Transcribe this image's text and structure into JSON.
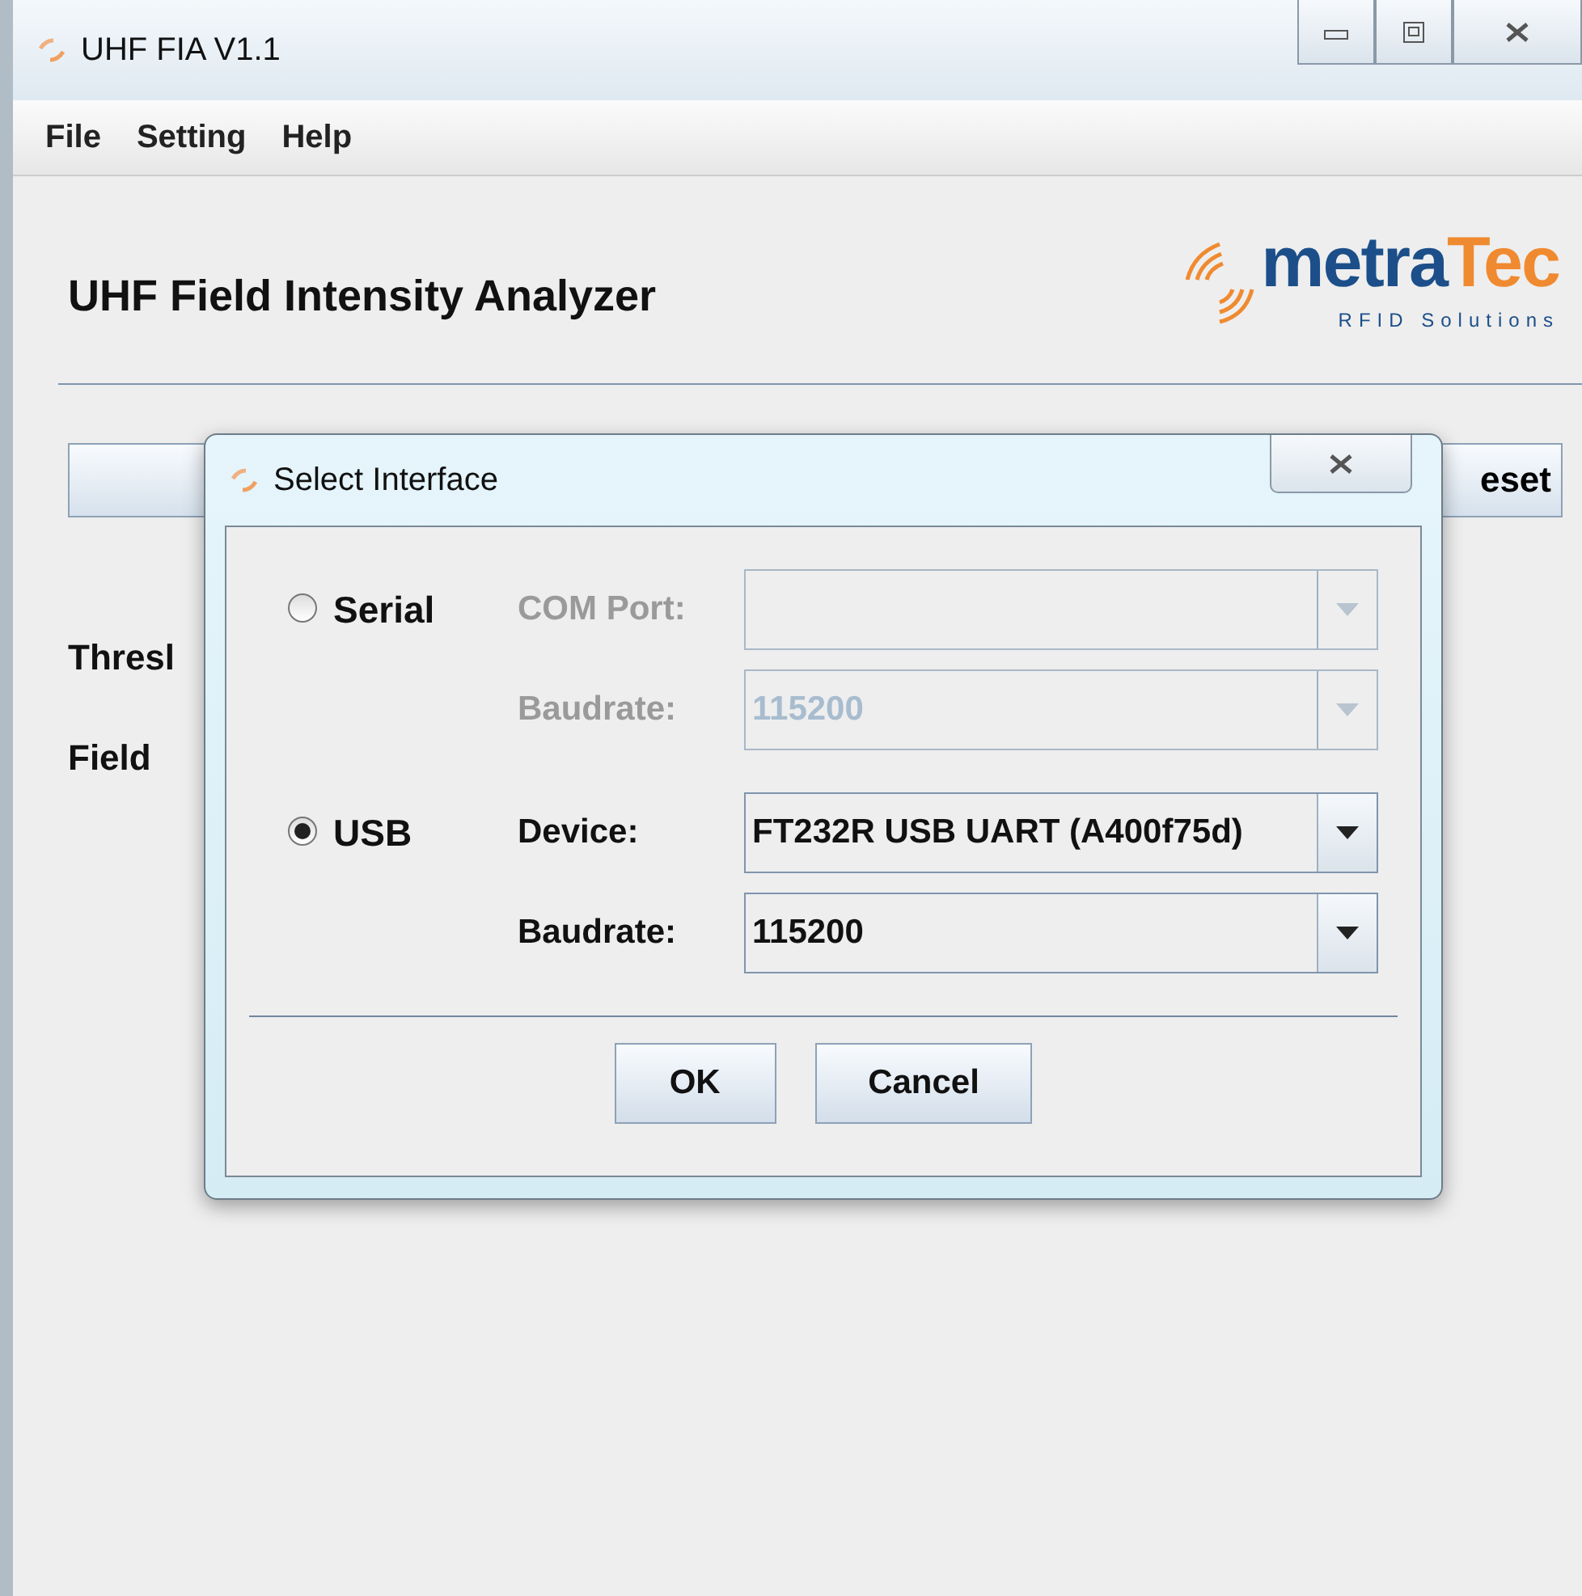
{
  "window": {
    "title": "UHF FIA V1.1"
  },
  "menu": [
    "File",
    "Setting",
    "Help"
  ],
  "heading": "UHF Field Intensity Analyzer",
  "logo": {
    "brand_first": "metra",
    "brand_second": "Tec",
    "tagline": "RFID Solutions"
  },
  "background_buttons": [
    {
      "kind": "blank"
    },
    {
      "kind": "text",
      "label": "eset"
    }
  ],
  "background_labels": [
    "Thresl",
    "Field"
  ],
  "dialog": {
    "title": "Select Interface",
    "options": [
      {
        "label": "Serial",
        "selected": false,
        "fields": [
          {
            "label": "COM Port:"
          },
          {
            "label": "Baudrate:",
            "value": "115200"
          }
        ]
      },
      {
        "label": "USB",
        "selected": true,
        "fields": [
          {
            "label": "Device:",
            "value": "FT232R USB UART (A400f75d)"
          },
          {
            "label": "Baudrate:",
            "value": "115200"
          }
        ]
      }
    ],
    "buttons": [
      "OK",
      "Cancel"
    ]
  }
}
